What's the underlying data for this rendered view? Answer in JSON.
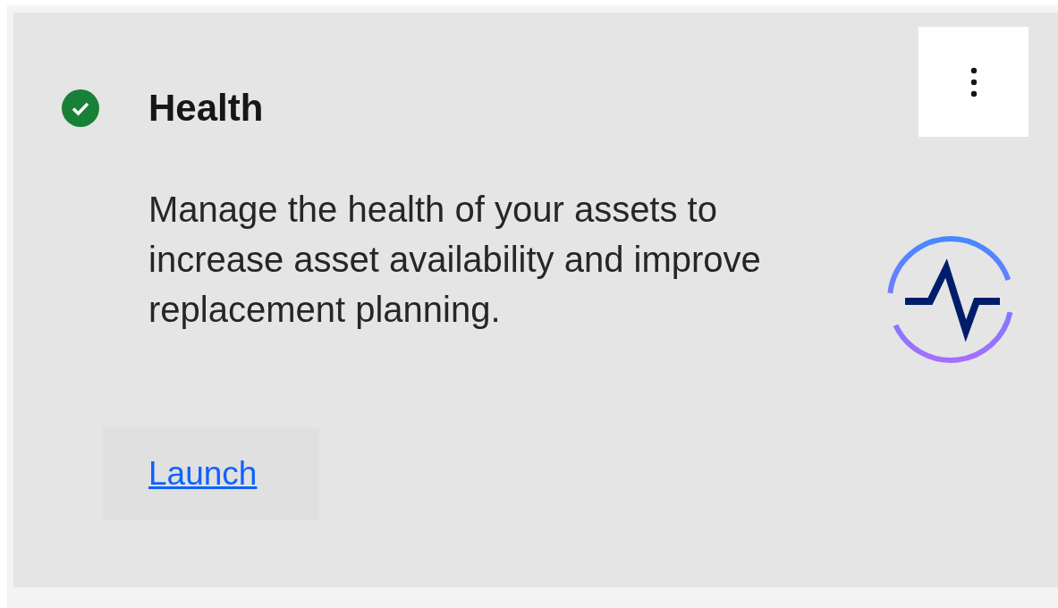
{
  "card": {
    "kind": "success",
    "title": "Health",
    "description": "Manage the health of your assets to increase asset availability and improve replacement planning.",
    "action": {
      "label": "Launch"
    }
  }
}
